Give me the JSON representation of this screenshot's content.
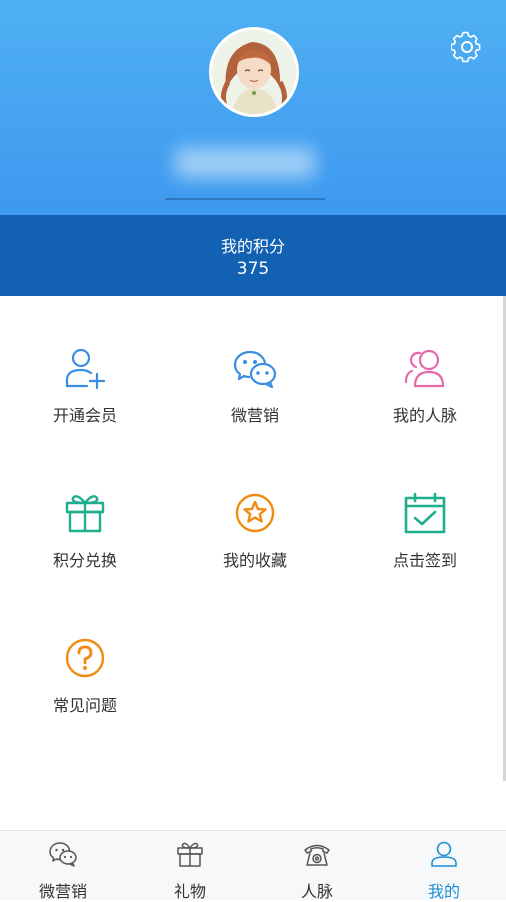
{
  "profile": {
    "avatar_icon": "girl-avatar-illustration",
    "settings_icon": "gear-icon"
  },
  "points": {
    "label": "我的积分",
    "value": "375"
  },
  "menu": {
    "items": [
      {
        "label": "开通会员",
        "icon": "add-user-icon",
        "color": "#3a8ee0"
      },
      {
        "label": "微营销",
        "icon": "wechat-icon",
        "color": "#3a8ee0"
      },
      {
        "label": "我的人脉",
        "icon": "people-icon",
        "color": "#e56aa8"
      },
      {
        "label": "积分兑换",
        "icon": "gift-icon",
        "color": "#1fae8e"
      },
      {
        "label": "我的收藏",
        "icon": "star-icon",
        "color": "#f08c12"
      },
      {
        "label": "点击签到",
        "icon": "calendar-check-icon",
        "color": "#1fae8e"
      },
      {
        "label": "常见问题",
        "icon": "question-icon",
        "color": "#f08c12"
      }
    ]
  },
  "tabbar": {
    "active_color": "#1e90d6",
    "items": [
      {
        "label": "微营销",
        "icon": "wechat-icon"
      },
      {
        "label": "礼物",
        "icon": "gift-icon"
      },
      {
        "label": "人脉",
        "icon": "telephone-icon"
      },
      {
        "label": "我的",
        "icon": "person-icon",
        "active": true
      }
    ]
  }
}
